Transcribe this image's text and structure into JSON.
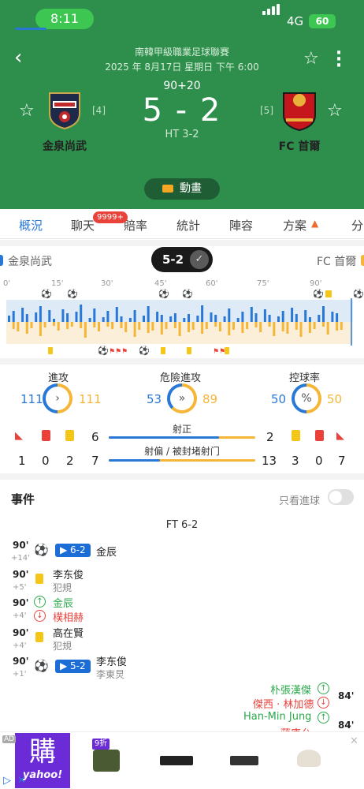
{
  "status_bar": {
    "time": "8:11",
    "network": "4G",
    "battery": "60"
  },
  "match": {
    "league": "南韓甲級職業足球聯賽",
    "datetime": "2025 年 8月17日 星期日 下午 6:00",
    "minute": "90+20",
    "score": "5 - 2",
    "half_time": "HT 3-2",
    "home": {
      "name": "金泉尚武",
      "rank": "[4]",
      "short": "金泉尚武"
    },
    "away": {
      "name": "FC 首爾",
      "rank": "[5]",
      "short": "FC 首爾"
    },
    "animation_label": "動畫"
  },
  "tabs": [
    {
      "label": "概況"
    },
    {
      "label": "聊天"
    },
    {
      "label": "賠率"
    },
    {
      "label": "統計"
    },
    {
      "label": "陣容"
    },
    {
      "label": "方案"
    },
    {
      "label": "分"
    }
  ],
  "chat_badge": "9999+",
  "scorebar_score": "5-2",
  "timeline": {
    "labels": [
      "0'",
      "15'",
      "30'",
      "45'",
      "60'",
      "75'",
      "90'"
    ],
    "home_color": "#2a78d6",
    "away_color": "#f5b638"
  },
  "stats": {
    "attack": {
      "title": "進攻",
      "home": "111",
      "away": "111",
      "icon": "›"
    },
    "dangerous": {
      "title": "危險進攻",
      "home": "53",
      "away": "89",
      "icon": "»"
    },
    "possession": {
      "title": "控球率",
      "home": "50",
      "away": "50",
      "icon": "%"
    },
    "on_target": {
      "label": "射正",
      "home": "6",
      "away": "2",
      "home_share": 0.75
    },
    "off_target": {
      "label": "射偏 / 被封堵射门",
      "home": "7",
      "away": "13",
      "home_share": 0.35
    },
    "home_corners": "1",
    "home_red": "0",
    "home_yellow": "2",
    "away_yellow": "3",
    "away_red": "0",
    "away_corners": "7"
  },
  "events": {
    "title": "事件",
    "goals_only": "只看進球",
    "ft_label": "FT 6-2",
    "list": [
      {
        "min": "90'",
        "add": "+14'",
        "badge": "▶ 6-2",
        "p1": "金辰",
        "p2": ""
      },
      {
        "min": "90'",
        "add": "+5'",
        "p1": "李东俊",
        "p2": "犯規"
      },
      {
        "min": "90'",
        "add": "+4'",
        "p1": "金辰",
        "p2": "樸相赫"
      },
      {
        "min": "90'",
        "add": "+4'",
        "p1": "高在賢",
        "p2": "犯規"
      },
      {
        "min": "90'",
        "add": "+1'",
        "badge": "▶ 5-2",
        "p1": "李东俊",
        "p2": "李東炅"
      },
      {
        "min": "84'",
        "p1": "朴張漢傑",
        "p2": "傑西 · 林加德"
      },
      {
        "min": "84'",
        "p1": "Han-Min Jung",
        "p2": "蔣康允"
      }
    ]
  },
  "ad": {
    "tag": "AD",
    "brand": "yahoo!",
    "char": "購",
    "discount": "9折"
  }
}
